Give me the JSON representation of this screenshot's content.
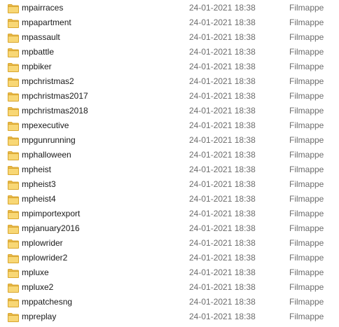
{
  "icon": "folder-icon",
  "colors": {
    "folder_body": "#F8D775",
    "folder_tab": "#E8B84A",
    "folder_edge": "#D9A62E",
    "secondary_text": "#6D6D6D"
  },
  "files": [
    {
      "name": "mpairraces",
      "date": "24-01-2021 18:38",
      "type": "Filmappe"
    },
    {
      "name": "mpapartment",
      "date": "24-01-2021 18:38",
      "type": "Filmappe"
    },
    {
      "name": "mpassault",
      "date": "24-01-2021 18:38",
      "type": "Filmappe"
    },
    {
      "name": "mpbattle",
      "date": "24-01-2021 18:38",
      "type": "Filmappe"
    },
    {
      "name": "mpbiker",
      "date": "24-01-2021 18:38",
      "type": "Filmappe"
    },
    {
      "name": "mpchristmas2",
      "date": "24-01-2021 18:38",
      "type": "Filmappe"
    },
    {
      "name": "mpchristmas2017",
      "date": "24-01-2021 18:38",
      "type": "Filmappe"
    },
    {
      "name": "mpchristmas2018",
      "date": "24-01-2021 18:38",
      "type": "Filmappe"
    },
    {
      "name": "mpexecutive",
      "date": "24-01-2021 18:38",
      "type": "Filmappe"
    },
    {
      "name": "mpgunrunning",
      "date": "24-01-2021 18:38",
      "type": "Filmappe"
    },
    {
      "name": "mphalloween",
      "date": "24-01-2021 18:38",
      "type": "Filmappe"
    },
    {
      "name": "mpheist",
      "date": "24-01-2021 18:38",
      "type": "Filmappe"
    },
    {
      "name": "mpheist3",
      "date": "24-01-2021 18:38",
      "type": "Filmappe"
    },
    {
      "name": "mpheist4",
      "date": "24-01-2021 18:38",
      "type": "Filmappe"
    },
    {
      "name": "mpimportexport",
      "date": "24-01-2021 18:38",
      "type": "Filmappe"
    },
    {
      "name": "mpjanuary2016",
      "date": "24-01-2021 18:38",
      "type": "Filmappe"
    },
    {
      "name": "mplowrider",
      "date": "24-01-2021 18:38",
      "type": "Filmappe"
    },
    {
      "name": "mplowrider2",
      "date": "24-01-2021 18:38",
      "type": "Filmappe"
    },
    {
      "name": "mpluxe",
      "date": "24-01-2021 18:38",
      "type": "Filmappe"
    },
    {
      "name": "mpluxe2",
      "date": "24-01-2021 18:38",
      "type": "Filmappe"
    },
    {
      "name": "mppatchesng",
      "date": "24-01-2021 18:38",
      "type": "Filmappe"
    },
    {
      "name": "mpreplay",
      "date": "24-01-2021 18:38",
      "type": "Filmappe"
    }
  ]
}
